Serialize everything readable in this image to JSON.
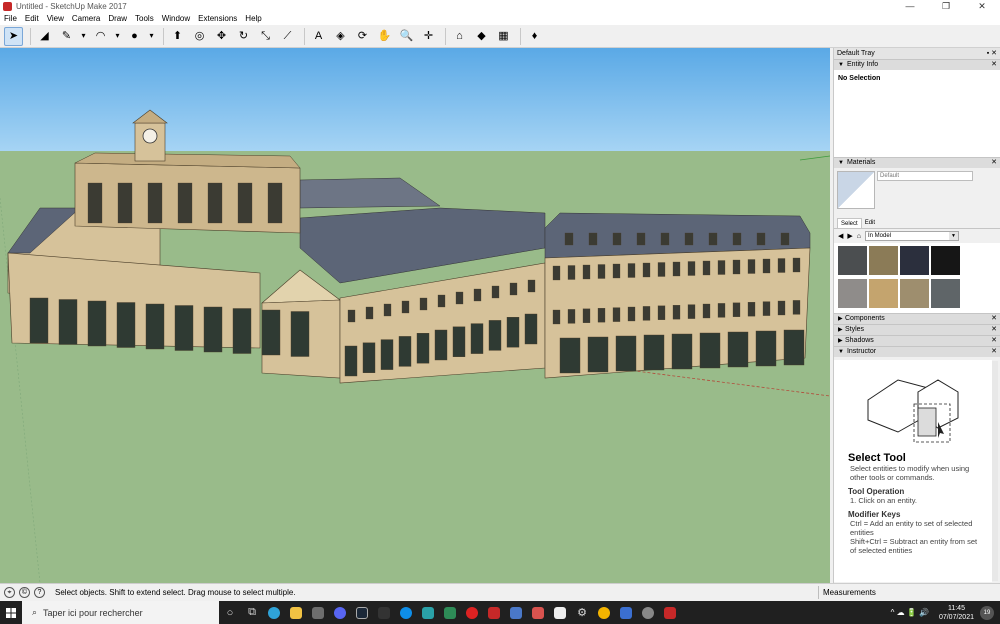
{
  "window": {
    "title": "Untitled - SketchUp Make 2017",
    "controls": [
      "—",
      "❐",
      "✕"
    ]
  },
  "menu": [
    "File",
    "Edit",
    "View",
    "Camera",
    "Draw",
    "Tools",
    "Window",
    "Extensions",
    "Help"
  ],
  "toolbar": {
    "tools": [
      {
        "name": "select-tool",
        "glyph": "➤",
        "active": true
      },
      {
        "name": "eraser-tool",
        "glyph": "◢"
      },
      {
        "name": "pencil-line-tool",
        "glyph": "✎"
      },
      {
        "name": "line-dropdown",
        "glyph": "▾"
      },
      {
        "name": "arc-tool",
        "glyph": "◠"
      },
      {
        "name": "arc-dropdown",
        "glyph": "▾"
      },
      {
        "name": "shape-tool",
        "glyph": "●"
      },
      {
        "name": "shape-dropdown",
        "glyph": "▾"
      },
      {
        "name": "push-pull-tool",
        "glyph": "⬆"
      },
      {
        "name": "offset-tool",
        "glyph": "◎"
      },
      {
        "name": "move-tool",
        "glyph": "✥"
      },
      {
        "name": "rotate-tool",
        "glyph": "↻"
      },
      {
        "name": "scale-tool",
        "glyph": "⤡"
      },
      {
        "name": "tape-measure-tool",
        "glyph": "⟋"
      },
      {
        "name": "text-tool",
        "glyph": "A"
      },
      {
        "name": "paint-bucket-tool",
        "glyph": "◈"
      },
      {
        "name": "orbit-tool",
        "glyph": "⟳"
      },
      {
        "name": "pan-tool",
        "glyph": "✋"
      },
      {
        "name": "zoom-tool",
        "glyph": "🔍"
      },
      {
        "name": "zoom-extents-tool",
        "glyph": "✛"
      },
      {
        "name": "warehouse-tool",
        "glyph": "⌂"
      },
      {
        "name": "extension-warehouse-tool",
        "glyph": "◆"
      },
      {
        "name": "send-to-layout-tool",
        "glyph": "▦"
      },
      {
        "name": "ruby-tool",
        "glyph": "♦"
      }
    ]
  },
  "tray": {
    "title": "Default Tray",
    "entity_info": {
      "header": "Entity Info",
      "selection": "No Selection"
    },
    "materials": {
      "header": "Materials",
      "name": "Default",
      "tabs": [
        "Select",
        "Edit"
      ],
      "library": "In Model",
      "swatches": [
        "#4b4e50",
        "#8b7b57",
        "#2b2f3d",
        "#161616",
        "#8f8c8a",
        "#c4a46e",
        "#9e8e6e",
        "#5f6568"
      ]
    },
    "collapsed": [
      "Components",
      "Styles",
      "Shadows"
    ],
    "instructor": {
      "header": "Instructor",
      "title": "Select Tool",
      "desc": "Select entities to modify when using other tools or commands.",
      "op_head": "Tool Operation",
      "op_1": "1. Click on an entity.",
      "mod_head": "Modifier Keys",
      "mod_1": "Ctrl = Add an entity to set of selected entities",
      "mod_2": "Shift+Ctrl = Subtract an entity from set of selected entities"
    }
  },
  "status": {
    "message": "Select objects. Shift to extend select. Drag mouse to select multiple.",
    "measurements": "Measurements"
  },
  "taskbar": {
    "search_placeholder": "Taper ici pour rechercher",
    "time": "11:45",
    "date": "07/07/2021",
    "notifications": "19",
    "tray_icons": "^ ☁ 🔋 🔊"
  },
  "colors": {
    "sky_top": "#5aa9e6",
    "ground": "#99bb8a",
    "facade": "#d6c29a",
    "roof": "#5c6577"
  }
}
